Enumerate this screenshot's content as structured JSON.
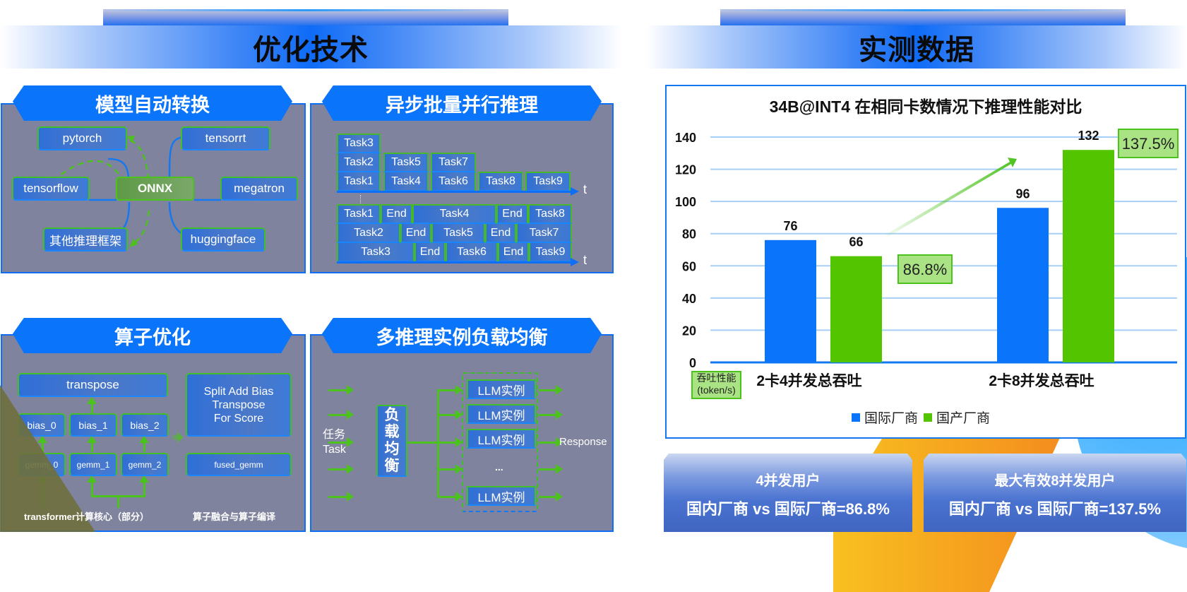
{
  "left_section": {
    "title": "优化技术"
  },
  "right_section": {
    "title": "实测数据"
  },
  "panel_model_convert": {
    "title": "模型自动转换",
    "center": "ONNX",
    "nodes": [
      "pytorch",
      "tensorrt",
      "tensorflow",
      "megatron",
      "其他推理框架",
      "huggingface"
    ]
  },
  "panel_async_batch": {
    "title": "异步批量并行推理",
    "top": {
      "rows": [
        [
          "Task3"
        ],
        [
          "Task2",
          "Task5",
          "Task7"
        ],
        [
          "Task1",
          "Task4",
          "Task6",
          "Task8",
          "Task9"
        ]
      ]
    },
    "bottom": {
      "rows": [
        [
          "Task1",
          "End",
          "Task4",
          "End",
          "Task8"
        ],
        [
          "Task2",
          "End",
          "Task5",
          "End",
          "Task7"
        ],
        [
          "Task3",
          "End",
          "Task6",
          "End",
          "Task9"
        ]
      ]
    },
    "axis_label": "t"
  },
  "panel_operator": {
    "title": "算子优化",
    "transpose": "transpose",
    "bias": [
      "bias_0",
      "bias_1",
      "bias_2"
    ],
    "gemm": [
      "gemm_0",
      "gemm_1",
      "gemm_2"
    ],
    "fused_top": "Split Add Bias Transpose For Score",
    "fused_top_lines": [
      "Split Add Bias",
      "Transpose",
      "For Score"
    ],
    "fused_gemm": "fused_gemm",
    "caption_left": "transformer计算核心（部分）",
    "caption_right": "算子融合与算子编译"
  },
  "panel_load_balance": {
    "title": "多推理实例负载均衡",
    "task_label_cn": "任务",
    "task_label_en": "Task",
    "balancer": [
      "负",
      "载",
      "均",
      "衡"
    ],
    "instances": [
      "LLM实例",
      "LLM实例",
      "LLM实例",
      "...",
      "LLM实例"
    ],
    "response": "Response"
  },
  "chart_data": {
    "type": "bar",
    "title": "34B@INT4 在相同卡数情况下推理性能对比",
    "categories": [
      "2卡4并发总吞吐",
      "2卡8并发总吞吐"
    ],
    "series": [
      {
        "name": "国际厂商",
        "values": [
          76,
          96
        ],
        "color": "#0a74fb"
      },
      {
        "name": "国产厂商",
        "values": [
          66,
          132
        ],
        "color": "#52c400"
      }
    ],
    "ylabel": "吞吐性能 (token/s)",
    "ylabel_lines": [
      "吞吐性能",
      "(token/s)"
    ],
    "yticks": [
      0,
      20,
      40,
      60,
      80,
      100,
      120,
      140
    ],
    "ylim": [
      0,
      140
    ],
    "grid": true,
    "legend": "bottom",
    "annotations": [
      "86.8%",
      "137.5%"
    ]
  },
  "cards": [
    {
      "line1": "4并发用户",
      "line2": "国内厂商 vs 国际厂商=86.8%"
    },
    {
      "line1": "最大有效8并发用户",
      "line2": "国内厂商 vs 国际厂商=137.5%"
    }
  ]
}
